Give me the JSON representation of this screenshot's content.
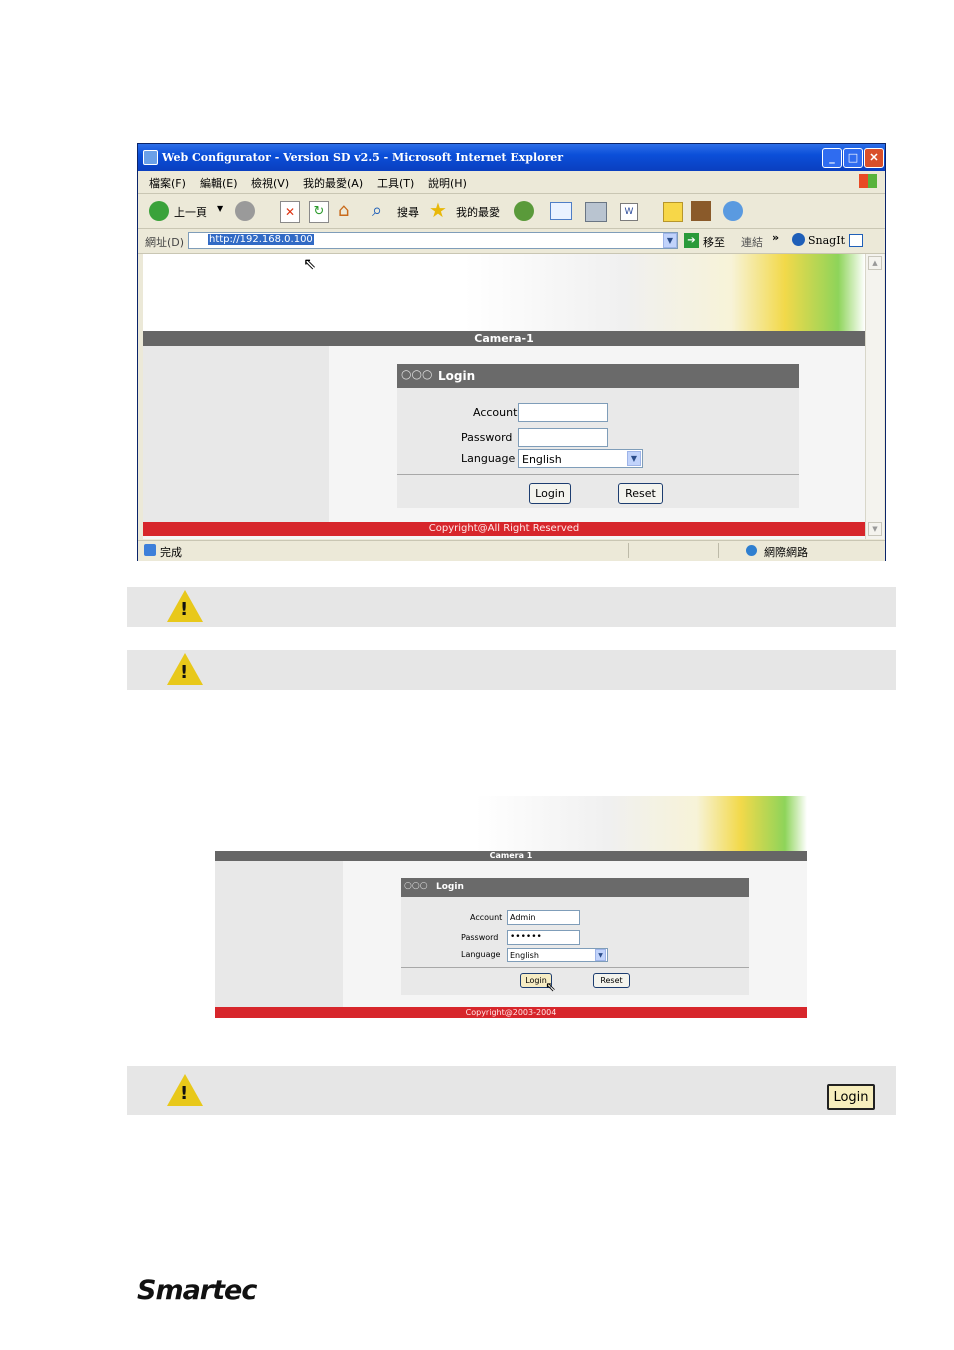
{
  "window": {
    "title": "Web Configurator - Version SD v2.5 - Microsoft Internet Explorer",
    "menu": [
      "檔案(F)",
      "編輯(E)",
      "檢視(V)",
      "我的最愛(A)",
      "工具(T)",
      "說明(H)"
    ],
    "toolbar": {
      "back_label": "上一頁",
      "search_label": "搜尋",
      "favorites_label": "我的最愛"
    },
    "address": {
      "label": "網址(D)",
      "url": "http://192.168.0.100",
      "go_label": "移至",
      "links_label": "連結",
      "chevron": "»",
      "snagit_label": "SnagIt"
    },
    "status": {
      "done": "完成",
      "zone": "網際網路"
    }
  },
  "page1": {
    "camera_title": "Camera-1",
    "login_title": "Login",
    "account_label": "Account",
    "password_label": "Password",
    "language_label": "Language",
    "language_value": "English",
    "login_button": "Login",
    "reset_button": "Reset",
    "copyright": "Copyright@All Right Reserved"
  },
  "page2": {
    "camera_title": "Camera 1",
    "login_title": "Login",
    "account_label": "Account",
    "account_value": "Admin",
    "password_label": "Password",
    "password_value": "••••••",
    "language_label": "Language",
    "language_value": "English",
    "login_button": "Login",
    "reset_button": "Reset",
    "copyright": "Copyright@2003-2004"
  },
  "notes": {
    "login_button_sample": "Login"
  },
  "brand": {
    "logo_text": "Smartec"
  },
  "colors": {
    "titlebar": "#0b4fd9",
    "gray_bar": "#666666",
    "red_bar": "#d7262b",
    "warning": "#e8c81a"
  }
}
